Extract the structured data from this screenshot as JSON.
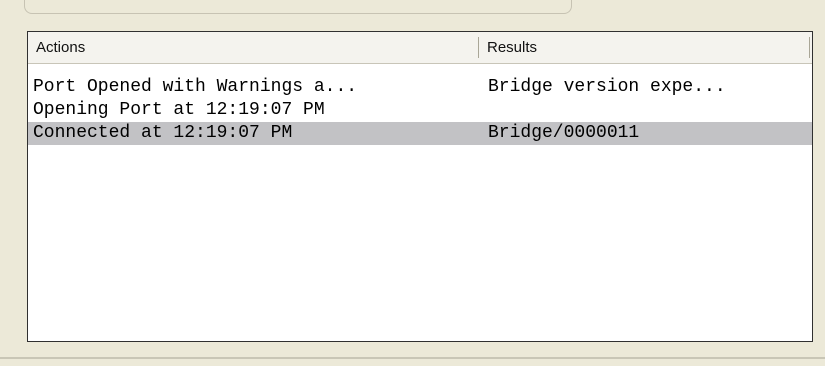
{
  "list": {
    "columns": {
      "actions": "Actions",
      "results": "Results"
    },
    "rows": [
      {
        "action": "Port Opened with Warnings a...",
        "result": "Bridge version expe...",
        "selected": false
      },
      {
        "action": "Opening Port at 12:19:07 PM",
        "result": "",
        "selected": false
      },
      {
        "action": "Connected at 12:19:07 PM",
        "result": "Bridge/0000011",
        "selected": true
      }
    ]
  },
  "colors": {
    "selected_row": "#c2c2c5",
    "window_background": "#ece9d8"
  }
}
